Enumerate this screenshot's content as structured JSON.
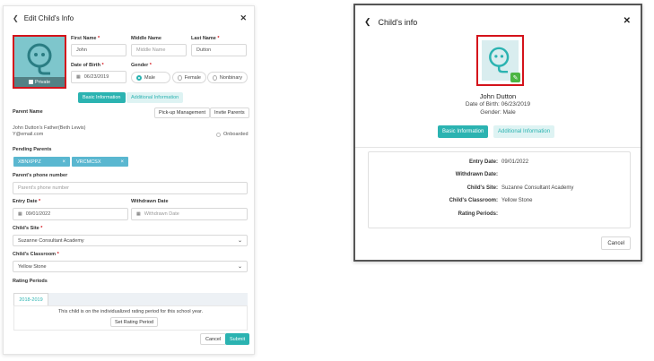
{
  "left_dialog": {
    "title": "Edit Child's Info",
    "private_label": "Private",
    "fields": {
      "first_name": {
        "label": "First Name",
        "value": "John"
      },
      "middle_name": {
        "label": "Middle Name",
        "placeholder": "Middle Name"
      },
      "last_name": {
        "label": "Last Name",
        "value": "Dutton"
      },
      "dob": {
        "label": "Date of Birth",
        "value": "06/23/2019"
      },
      "gender": {
        "label": "Gender",
        "options": [
          "Male",
          "Female",
          "Nonbinary"
        ],
        "selected": "Male"
      }
    },
    "tabs": [
      "Basic Information",
      "Additional Information"
    ],
    "parent_section": {
      "heading": "Parent Name",
      "pickup_button": "Pick-up Management",
      "invite_button": "Invite Parents",
      "parent_name": "John Dutton's Father(Beth Lewis)",
      "parent_email": "Y@email.com",
      "onboarded_label": "Onboarded"
    },
    "pending_parents": {
      "heading": "Pending Parents",
      "chips": [
        "XBNXPPZ",
        "VRCMCSX"
      ]
    },
    "phone": {
      "label": "Parent's phone number",
      "placeholder": "Parent's phone number"
    },
    "entry_date": {
      "label": "Entry Date",
      "value": "09/01/2022"
    },
    "withdrawn_date": {
      "label": "Withdrawn Date",
      "placeholder": "Withdrawn Date"
    },
    "site": {
      "label": "Child's Site",
      "value": "Suzanne Consultant Academy"
    },
    "classroom": {
      "label": "Child's Classroom",
      "value": "Yellow Stone"
    },
    "rating": {
      "heading": "Rating Periods",
      "tab": "2018-2019",
      "message": "This child is on the individualized rating period for this school year.",
      "button": "Set Rating Period"
    },
    "cancel": "Cancel",
    "submit": "Submit"
  },
  "right_dialog": {
    "title": "Child's info",
    "name": "John Dutton",
    "dob_line": "Date of Birth: 06/23/2019",
    "gender_line": "Gender: Male",
    "tabs": [
      "Basic Information",
      "Additional Information"
    ],
    "details": [
      {
        "key": "Entry Date:",
        "value": "09/01/2022"
      },
      {
        "key": "Withdrawn Date:",
        "value": ""
      },
      {
        "key": "Child's Site:",
        "value": "Suzanne Consultant Academy"
      },
      {
        "key": "Child's Classroom:",
        "value": "Yellow Stone"
      },
      {
        "key": "Rating Periods:",
        "value": ""
      }
    ],
    "cancel": "Cancel"
  },
  "colors": {
    "accent": "#2bb3b1",
    "highlight": "#d4131b",
    "chip": "#5ab7d0",
    "edit_badge": "#4bb543"
  }
}
